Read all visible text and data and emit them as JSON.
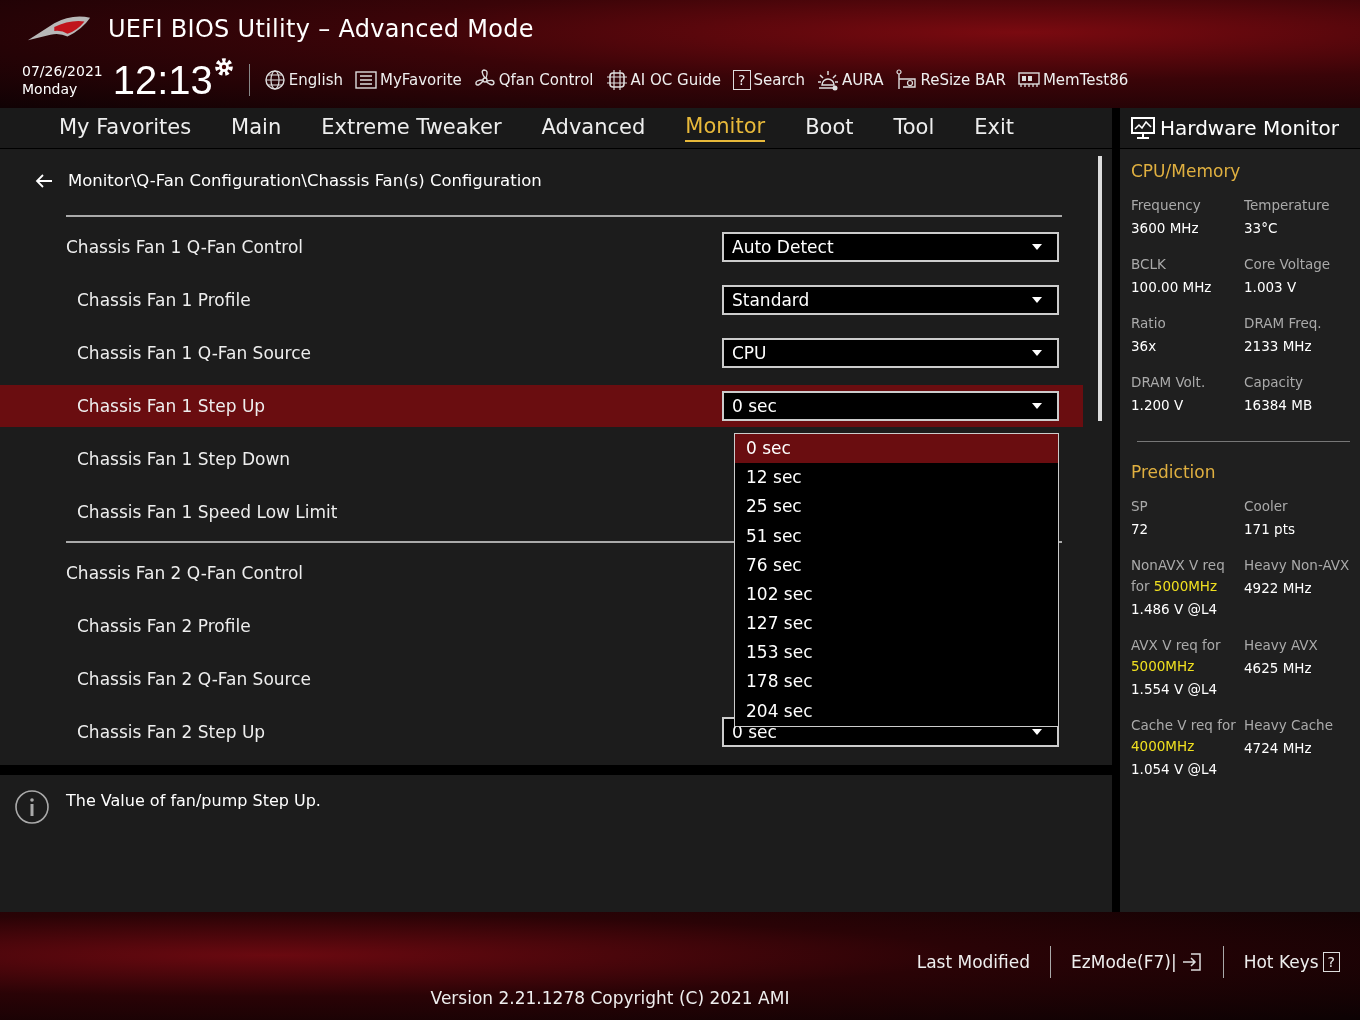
{
  "header": {
    "title": "UEFI BIOS Utility – Advanced Mode",
    "date": "07/26/2021",
    "day": "Monday",
    "time": "12:13",
    "tools": [
      {
        "label": "English",
        "kind": "globe"
      },
      {
        "label": "MyFavorite",
        "kind": "list"
      },
      {
        "label": "Qfan Control",
        "kind": "fan"
      },
      {
        "label": "AI OC Guide",
        "kind": "chip"
      },
      {
        "label": "Search",
        "kind": "glyph",
        "glyph": "?"
      },
      {
        "label": "AURA",
        "kind": "light"
      },
      {
        "label": "ReSize BAR",
        "kind": "card"
      },
      {
        "label": "MemTest86",
        "kind": "memory"
      }
    ]
  },
  "tabs": [
    {
      "label": "My Favorites",
      "selected": false
    },
    {
      "label": "Main",
      "selected": false
    },
    {
      "label": "Extreme Tweaker",
      "selected": false
    },
    {
      "label": "Advanced",
      "selected": false
    },
    {
      "label": "Monitor",
      "selected": true
    },
    {
      "label": "Boot",
      "selected": false
    },
    {
      "label": "Tool",
      "selected": false
    },
    {
      "label": "Exit",
      "selected": false
    }
  ],
  "breadcrumb": "Monitor\\Q-Fan Configuration\\Chassis Fan(s) Configuration",
  "groups": [
    {
      "label": "Chassis Fan 1 Q-Fan Control",
      "value": "Auto Detect",
      "selected": false,
      "children": [
        {
          "label": "Chassis Fan 1 Profile",
          "value": "Standard",
          "selected": false
        },
        {
          "label": "Chassis Fan 1 Q-Fan Source",
          "value": "CPU",
          "selected": false
        },
        {
          "label": "Chassis Fan 1 Step Up",
          "value": "0 sec",
          "selected": true
        },
        {
          "label": "Chassis Fan 1 Step Down",
          "selected": false
        },
        {
          "label": "Chassis Fan 1 Speed Low Limit",
          "selected": false
        }
      ]
    },
    {
      "label": "Chassis Fan 2 Q-Fan Control",
      "selected": false,
      "children": [
        {
          "label": "Chassis Fan 2 Profile",
          "selected": false
        },
        {
          "label": "Chassis Fan 2 Q-Fan Source",
          "selected": false
        },
        {
          "label": "Chassis Fan 2 Step Up",
          "value": "0 sec",
          "selected": false
        }
      ]
    }
  ],
  "dropdown_options": [
    {
      "label": "0 sec",
      "selected": true
    },
    {
      "label": "12 sec",
      "selected": false
    },
    {
      "label": "25 sec",
      "selected": false
    },
    {
      "label": "51 sec",
      "selected": false
    },
    {
      "label": "76 sec",
      "selected": false
    },
    {
      "label": "102 sec",
      "selected": false
    },
    {
      "label": "127 sec",
      "selected": false
    },
    {
      "label": "153 sec",
      "selected": false
    },
    {
      "label": "178 sec",
      "selected": false
    },
    {
      "label": "204 sec",
      "selected": false
    }
  ],
  "help_text": "The Value of fan/pump Step Up.",
  "hardware_monitor": {
    "title": "Hardware Monitor",
    "sections": [
      {
        "title": "CPU/Memory",
        "items": [
          {
            "label": "Frequency",
            "value": "3600 MHz"
          },
          {
            "label": "Temperature",
            "value": "33°C"
          },
          {
            "label": "BCLK",
            "value": "100.00 MHz"
          },
          {
            "label": "Core Voltage",
            "value": "1.003 V"
          },
          {
            "label": "Ratio",
            "value": "36x"
          },
          {
            "label": "DRAM Freq.",
            "value": "2133 MHz"
          },
          {
            "label": "DRAM Volt.",
            "value": "1.200 V"
          },
          {
            "label": "Capacity",
            "value": "16384 MB"
          }
        ]
      },
      {
        "title": "Prediction",
        "items": [
          {
            "label": "SP",
            "value": "72"
          },
          {
            "label": "Cooler",
            "value": "171 pts"
          },
          {
            "label": "NonAVX V req for **5000MHz**",
            "value": "1.486 V @L4"
          },
          {
            "label": "Heavy Non-AVX",
            "value": "4922 MHz"
          },
          {
            "label": "AVX V req for **5000MHz**",
            "value": "1.554 V @L4"
          },
          {
            "label": "Heavy AVX",
            "value": "4625 MHz"
          },
          {
            "label": "Cache V req for **4000MHz**",
            "value": "1.054 V @L4"
          },
          {
            "label": "Heavy Cache",
            "value": "4724 MHz"
          }
        ]
      }
    ]
  },
  "footer": {
    "links": [
      {
        "label": "Last Modified",
        "kind": "text"
      },
      {
        "label": "EzMode(F7)|",
        "kind": "exit"
      },
      {
        "label": "Hot Keys",
        "kind": "glyph",
        "glyph": "?"
      }
    ],
    "version": "Version 2.21.1278 Copyright (C) 2021 AMI"
  }
}
